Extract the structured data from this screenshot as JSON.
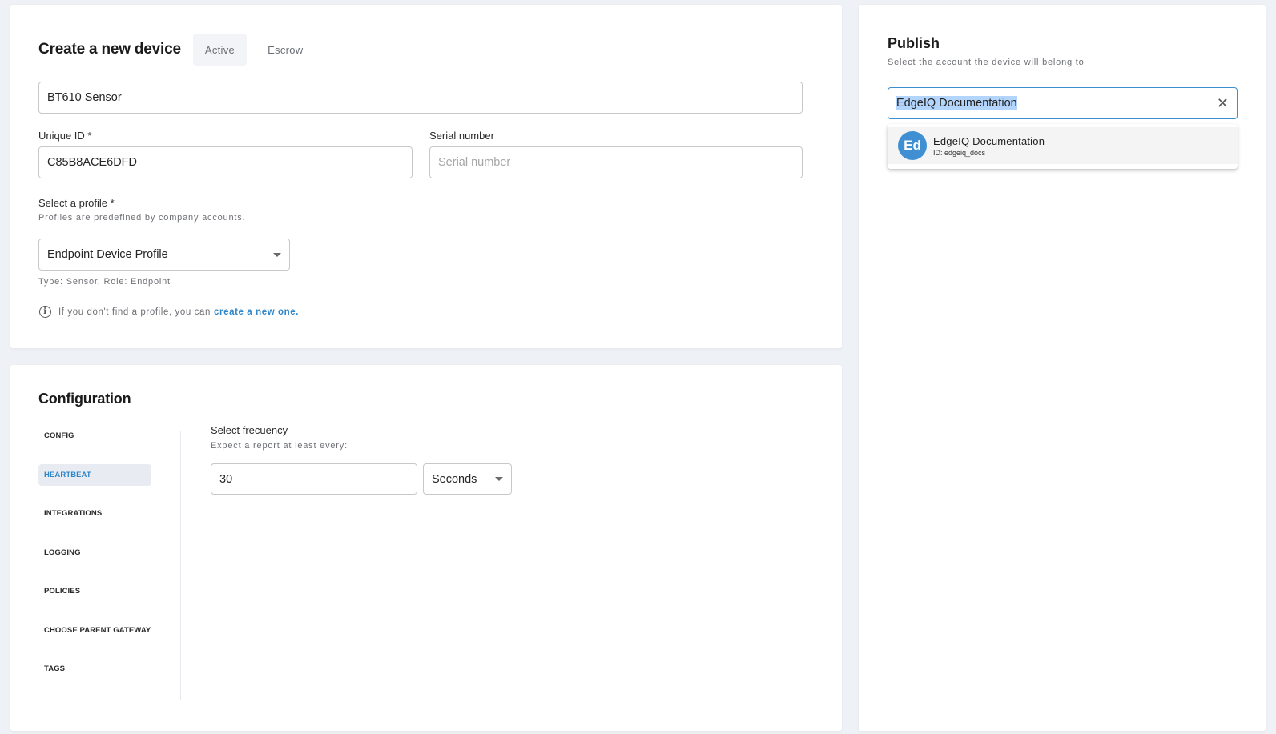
{
  "create_device": {
    "title": "Create a new device",
    "tabs": [
      {
        "label": "Active",
        "selected": true
      },
      {
        "label": "Escrow",
        "selected": false
      }
    ],
    "device_name": {
      "value": "BT610 Sensor"
    },
    "unique_id": {
      "label": "Unique ID *",
      "value": "C85B8ACE6DFD"
    },
    "serial_number": {
      "label": "Serial number",
      "value": "",
      "placeholder": "Serial number"
    },
    "profile": {
      "label": "Select a profile *",
      "hint": "Profiles are predefined by company accounts.",
      "selected": "Endpoint Device Profile",
      "details": "Type: Sensor, Role: Endpoint",
      "info_text": "If you don't find a profile, you can",
      "info_link": "create a new one."
    }
  },
  "configuration": {
    "title": "Configuration",
    "nav": [
      {
        "label": "CONFIG",
        "active": false
      },
      {
        "label": "HEARTBEAT",
        "active": true
      },
      {
        "label": "INTEGRATIONS",
        "active": false
      },
      {
        "label": "LOGGING",
        "active": false
      },
      {
        "label": "POLICIES",
        "active": false
      },
      {
        "label": "CHOOSE PARENT GATEWAY",
        "active": false
      },
      {
        "label": "TAGS",
        "active": false
      }
    ],
    "heartbeat": {
      "label": "Select frecuency",
      "hint": "Expect a report at least every:",
      "value": "30",
      "unit": "Seconds"
    }
  },
  "publish": {
    "title": "Publish",
    "hint": "Select the account the device will belong to",
    "account_value": "EdgeIQ Documentation",
    "options": [
      {
        "initials": "Ed",
        "name": "EdgeIQ Documentation",
        "id": "ID: edgeiq_docs"
      }
    ]
  },
  "colors": {
    "accent": "#2f86c9",
    "background": "#eef1f5",
    "avatar": "#3f8fd2",
    "selection": "#b3d4fb"
  }
}
